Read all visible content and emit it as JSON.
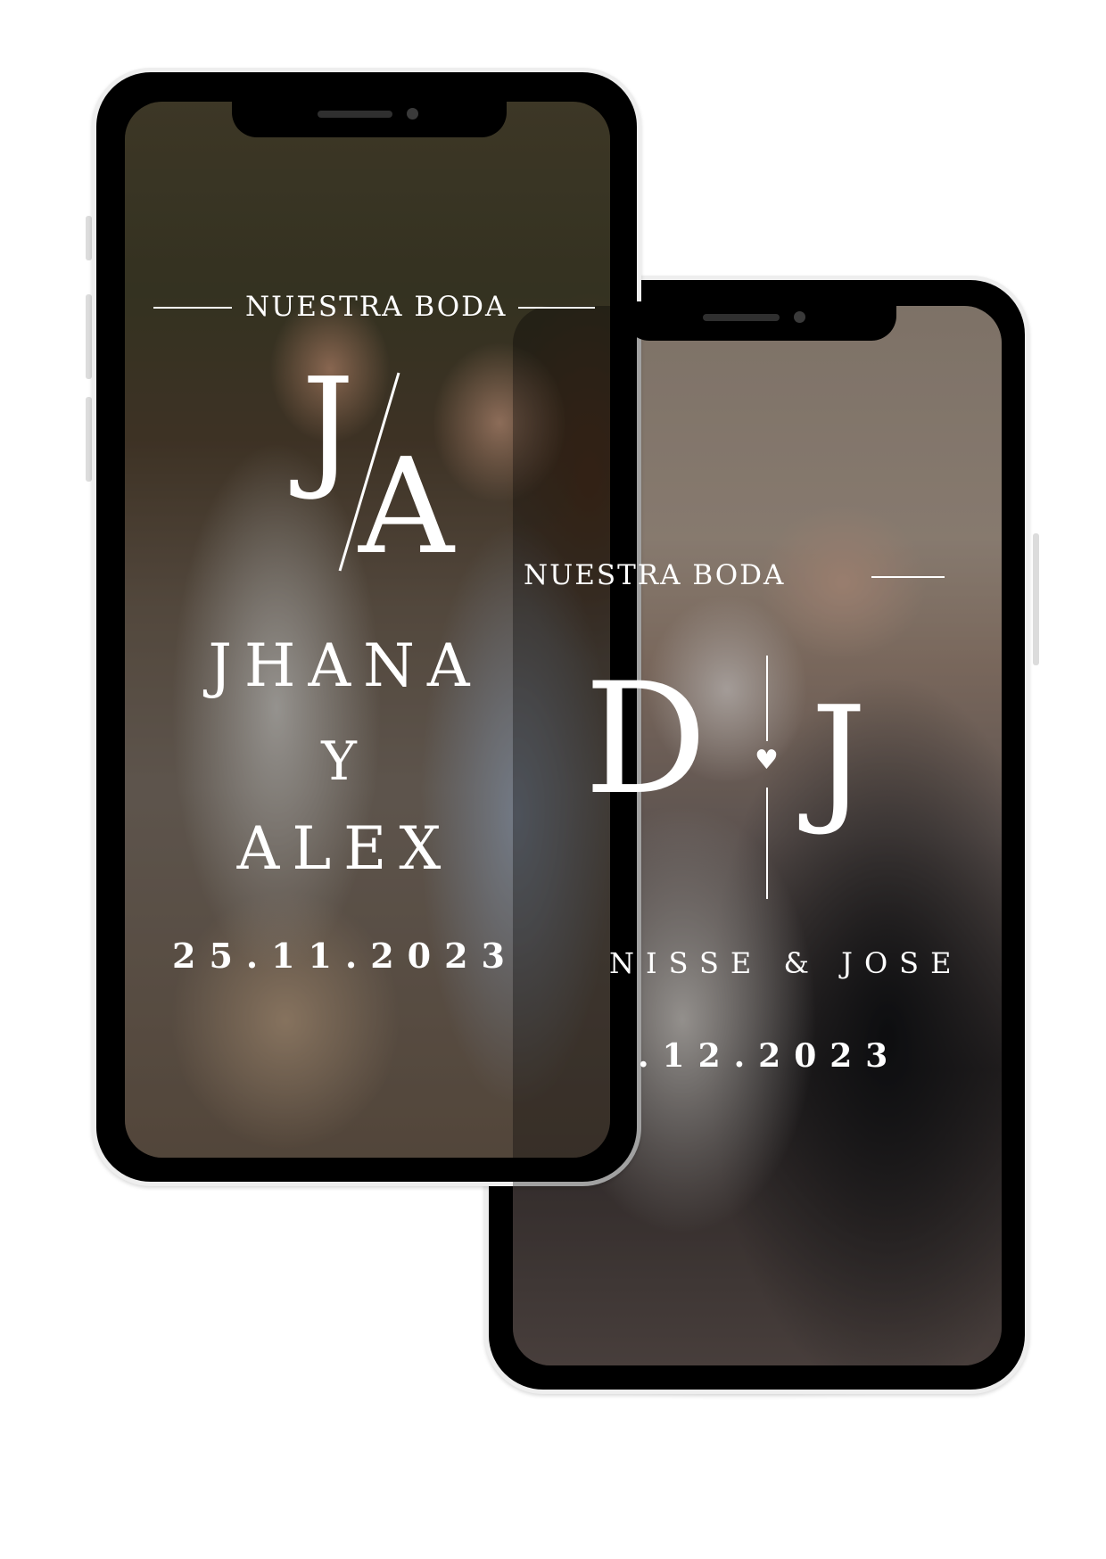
{
  "colors": {
    "background": "#ffffff",
    "phone_frame": "#000000",
    "phone_border": "#eeeeee",
    "text": "#ffffff"
  },
  "phone_left": {
    "header": "NUESTRA BODA",
    "monogram_first": "J",
    "monogram_second": "A",
    "name_first": "JHANA",
    "connector": "Y",
    "name_second": "ALEX",
    "date": "25.11.2023"
  },
  "phone_right": {
    "header": "NUESTRA BODA",
    "monogram_first": "D",
    "monogram_second": "J",
    "heart_icon": "heart-icon",
    "names": "NISSE & JOSE",
    "date": ".12.2023"
  }
}
